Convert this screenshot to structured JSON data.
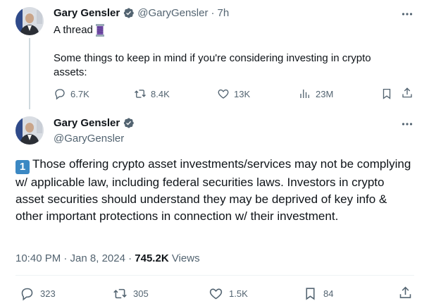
{
  "tweet1": {
    "name": "Gary Gensler",
    "handle": "@GaryGensler",
    "separator": "·",
    "time": "7h",
    "line1": "A thread",
    "line2": "Some things to keep in mind if you're considering investing in crypto assets:",
    "actions": {
      "replies": "6.7K",
      "reposts": "8.4K",
      "likes": "13K",
      "views": "23M"
    }
  },
  "tweet2": {
    "name": "Gary Gensler",
    "handle": "@GaryGensler",
    "number_badge": "1",
    "text": "Those offering crypto asset investments/services may not be complying w/ applicable law, including federal securities laws. Investors in crypto asset securities should understand they may be deprived of key info & other important protections in connection w/ their investment.",
    "timestamp": "10:40 PM · Jan 8, 2024 ·",
    "view_count": "745.2K",
    "views_label": "Views",
    "actions": {
      "replies": "323",
      "reposts": "305",
      "likes": "1.5K",
      "bookmarks": "84"
    }
  },
  "colors": {
    "verified": "#536471",
    "text_secondary": "#536471",
    "keycap": "#3b88c3"
  },
  "icons": [
    "more-icon",
    "verified-badge-icon",
    "reply-icon",
    "repost-icon",
    "like-icon",
    "views-icon",
    "bookmark-icon",
    "share-icon",
    "thread-spool-emoji"
  ]
}
